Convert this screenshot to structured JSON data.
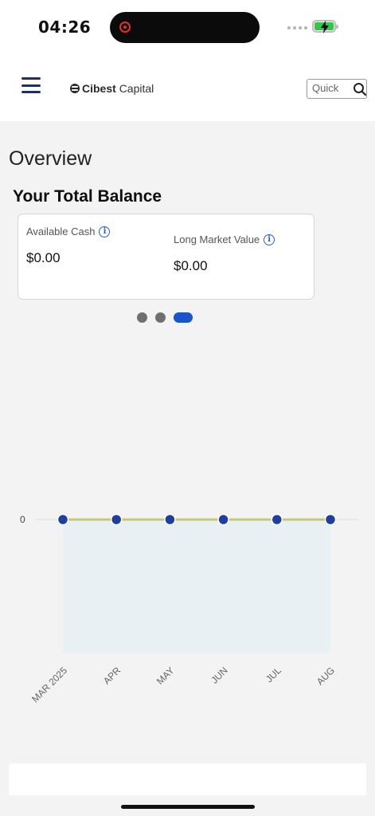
{
  "status_bar": {
    "time": "04:26"
  },
  "header": {
    "brand_bold": "Cibest",
    "brand_regular": "Capital",
    "search_placeholder": "Quick"
  },
  "main": {
    "section_title": "Overview",
    "balance_title": "Your Total Balance",
    "cards": [
      {
        "label": "Available Cash",
        "value": "$0.00"
      },
      {
        "label": "Long Market Value",
        "value": "$0.00"
      }
    ],
    "pager": {
      "count": 3,
      "active_index": 2
    }
  },
  "chart_data": {
    "type": "area",
    "x": [
      "MAR 2025",
      "APR",
      "MAY",
      "JUN",
      "JUL",
      "AUG"
    ],
    "values": [
      0,
      0,
      0,
      0,
      0,
      0
    ],
    "y_tick_labels": [
      "0"
    ],
    "line_color": "#c7c77a",
    "point_color": "#1f3f9e",
    "fill_color": "#e9f0f4",
    "grid": true
  },
  "colors": {
    "brand_navy": "#1f2f5e",
    "accent_blue": "#1b53c8"
  }
}
